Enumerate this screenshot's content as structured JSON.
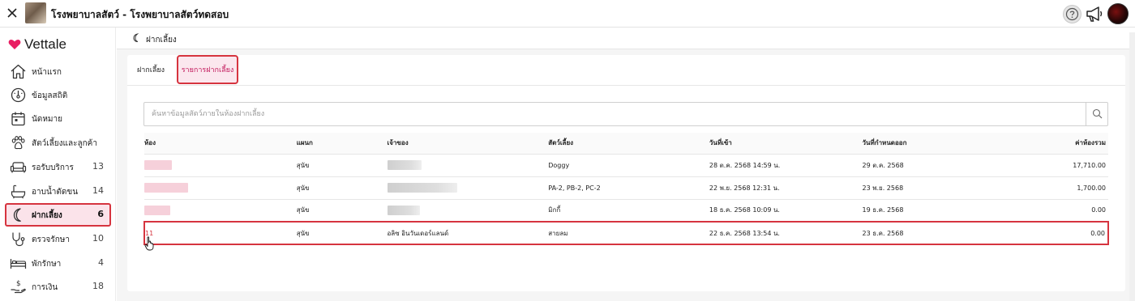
{
  "header": {
    "title": "โรงพยาบาลสัตว์ - โรงพยาบาลสัตว์ทดสอบ",
    "close_icon": "close-icon",
    "help_icon": "help-circle-icon",
    "announce_icon": "megaphone-icon"
  },
  "brand": {
    "name": "Vettale",
    "color": "#e91e63"
  },
  "sidebar": {
    "items": [
      {
        "label": "หน้าแรก",
        "count": "",
        "icon": "home-icon"
      },
      {
        "label": "ข้อมูลสถิติ",
        "count": "",
        "icon": "stats-gauge-icon"
      },
      {
        "label": "นัดหมาย",
        "count": "",
        "icon": "calendar-icon"
      },
      {
        "label": "สัตว์เลี้ยงและลูกค้า",
        "count": "",
        "icon": "paw-icon"
      },
      {
        "label": "รอรับบริการ",
        "count": "13",
        "icon": "sofa-icon"
      },
      {
        "label": "อาบน้ำตัดขน",
        "count": "14",
        "icon": "bathtub-icon"
      },
      {
        "label": "ฝากเลี้ยง",
        "count": "6",
        "icon": "moon-icon"
      },
      {
        "label": "ตรวจรักษา",
        "count": "10",
        "icon": "stethoscope-icon"
      },
      {
        "label": "พักรักษา",
        "count": "4",
        "icon": "bed-icon"
      },
      {
        "label": "การเงิน",
        "count": "18",
        "icon": "money-hand-icon"
      }
    ]
  },
  "page": {
    "breadcrumb": "ฝากเลี้ยง"
  },
  "tabs": [
    {
      "label": "ฝากเลี้ยง",
      "active": false
    },
    {
      "label": "รายการฝากเลี้ยง",
      "active": true
    }
  ],
  "search": {
    "placeholder": "ค้นหาข้อมูลสัตว์ภายในห้องฝากเลี้ยง",
    "value": ""
  },
  "table": {
    "columns": [
      "ห้อง",
      "แผนก",
      "เจ้าของ",
      "สัตว์เลี้ยง",
      "วันที่เข้า",
      "วันที่กำหนดออก",
      "ค่าห้องรวม"
    ],
    "rows": [
      {
        "room": "",
        "dept": "สุนัข",
        "owner": "",
        "pet": "Doggy",
        "in": "28 ต.ค. 2568 14:59 น.",
        "out": "29 ต.ค. 2568",
        "fee": "17,710.00"
      },
      {
        "room": "",
        "dept": "สุนัข",
        "owner": "",
        "pet": "PA-2, PB-2, PC-2",
        "in": "22 พ.ย. 2568 12:31 น.",
        "out": "23 พ.ย. 2568",
        "fee": "1,700.00"
      },
      {
        "room": "",
        "dept": "สุนัข",
        "owner": "",
        "pet": "มิกกี้",
        "in": "18 ธ.ค. 2568 10:09 น.",
        "out": "19 ธ.ค. 2568",
        "fee": "0.00"
      },
      {
        "room": "11",
        "dept": "สุนัข",
        "owner": "อลิซ อินวันเดอร์แลนด์",
        "pet": "สายลม",
        "in": "22 ธ.ค. 2568 13:54 น.",
        "out": "23 ธ.ค. 2568",
        "fee": "0.00"
      }
    ]
  },
  "colors": {
    "accent": "#d6343f",
    "active_bg": "#fbe3ea",
    "link": "#c2185b"
  }
}
